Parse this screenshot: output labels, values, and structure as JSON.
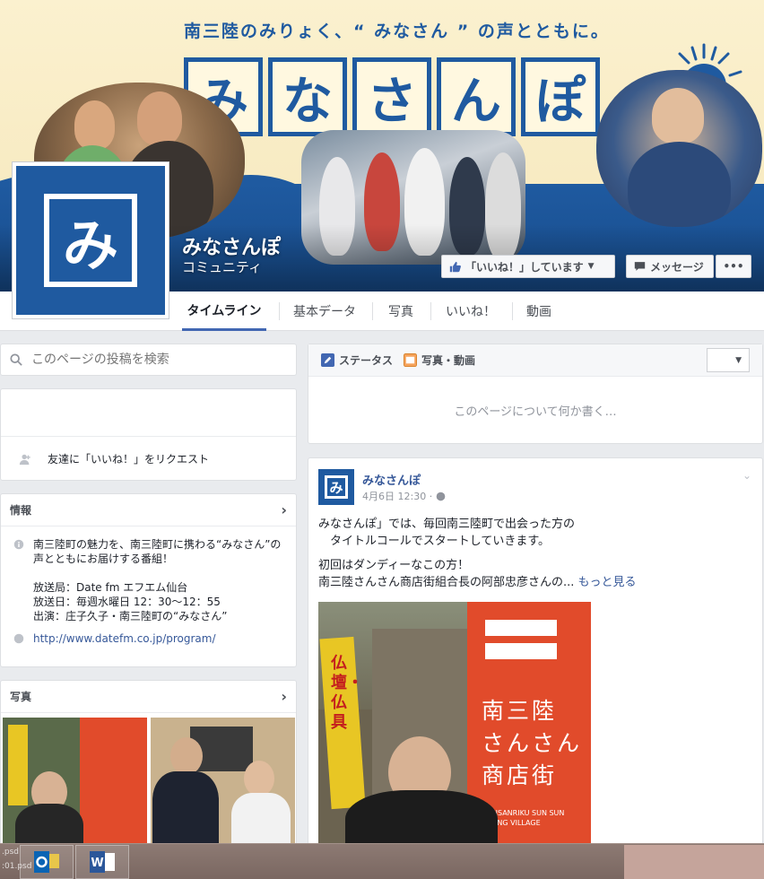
{
  "cover": {
    "tagline": "南三陸のみりょく、“ みなさん ” の声とともに。",
    "title_chars": [
      "み",
      "な",
      "さ",
      "ん",
      "ぽ"
    ]
  },
  "profile": {
    "logo_text": "み",
    "name": "みなさんぽ",
    "category": "コミュニティ"
  },
  "actions": {
    "liked_label": "「いいね！」しています",
    "message_label": "メッセージ",
    "more_label": "•••"
  },
  "tabs": [
    {
      "label": "タイムライン",
      "active": true
    },
    {
      "label": "基本データ"
    },
    {
      "label": "写真"
    },
    {
      "label": "いいね！"
    },
    {
      "label": "動画"
    }
  ],
  "search": {
    "placeholder": "このページの投稿を検索"
  },
  "invite": {
    "label": "友達に「いいね！」をリクエスト"
  },
  "info": {
    "header": "情報",
    "lines": [
      "南三陸町の魅力を、南三陸町に携わる“みなさん”の",
      "声とともにお届けする番組！",
      "",
      "放送局：Date fm エフエム仙台",
      "放送日：毎週水曜日 12：30〜12：55",
      "出演：庄子久子・南三陸町の“みなさん”"
    ],
    "link": "http://www.datefm.co.jp/program/"
  },
  "photos": {
    "header": "写真"
  },
  "composer": {
    "status_label": "ステータス",
    "photo_label": "写真・動画",
    "placeholder": "このページについて何か書く…"
  },
  "post": {
    "author": "みなさんぽ",
    "time": "4月6日 12:30 ·",
    "lines": [
      "みなさんぽ」では、毎回南三陸町で出会った方の",
      "　タイトルコールでスタートしていきます。"
    ],
    "lines2": [
      "初回はダンディーなこの方！",
      "南三陸さんさん商店街組合長の阿部忠彦さんの..."
    ],
    "see_more": "もっと見る",
    "banner_text": "南三陸\nさんさん\n商店街",
    "banner_sub": "MINAMISANRIKU SUN SUN\nSHOPPING VILLAGE",
    "flag_text": "仏壇・仏具"
  },
  "taskbar": {
    "left_label": ".psd\n:01.psd"
  },
  "colors": {
    "brand_blue": "#1f5aa0",
    "fb_blue": "#4267b2",
    "link": "#365899",
    "banner_red": "#e14b2b"
  }
}
